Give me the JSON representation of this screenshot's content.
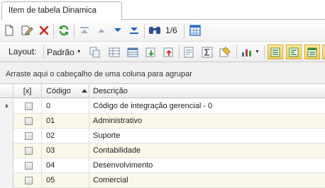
{
  "tab": {
    "title": "Item de tabela Dinamica"
  },
  "toolbar": {
    "record_position": "1/6",
    "icons": [
      "new-document-icon",
      "edit-icon",
      "delete-icon",
      "refresh-icon",
      "first-record-icon",
      "previous-record-icon",
      "next-record-icon",
      "last-record-icon",
      "find-icon",
      "column-chooser-icon"
    ]
  },
  "layout_bar": {
    "layout_label": "Layout:",
    "preset_label": "Padrão",
    "icons": [
      "copy-layout-icon",
      "grid-options-icon",
      "table-icon",
      "export-icon",
      "import-icon",
      "print-preview-icon",
      "sum-icon",
      "highlight-icon",
      "chart-icon",
      "view-mode-1-icon",
      "view-mode-2-icon",
      "view-mode-3-icon",
      "view-mode-4-icon"
    ]
  },
  "group_panel": {
    "hint": "Arraste aqui o cabeçalho de uma coluna para agrupar"
  },
  "grid": {
    "columns": {
      "check": "[x]",
      "code": "Código",
      "description": "Descrição"
    },
    "rows": [
      {
        "code": "0",
        "description": "Código de integração gerencial - 0"
      },
      {
        "code": "01",
        "description": "Administrativo"
      },
      {
        "code": "02",
        "description": "Suporte"
      },
      {
        "code": "03",
        "description": "Contabilidade"
      },
      {
        "code": "04",
        "description": "Desenvolvimento"
      },
      {
        "code": "05",
        "description": "Comercial"
      }
    ]
  }
}
